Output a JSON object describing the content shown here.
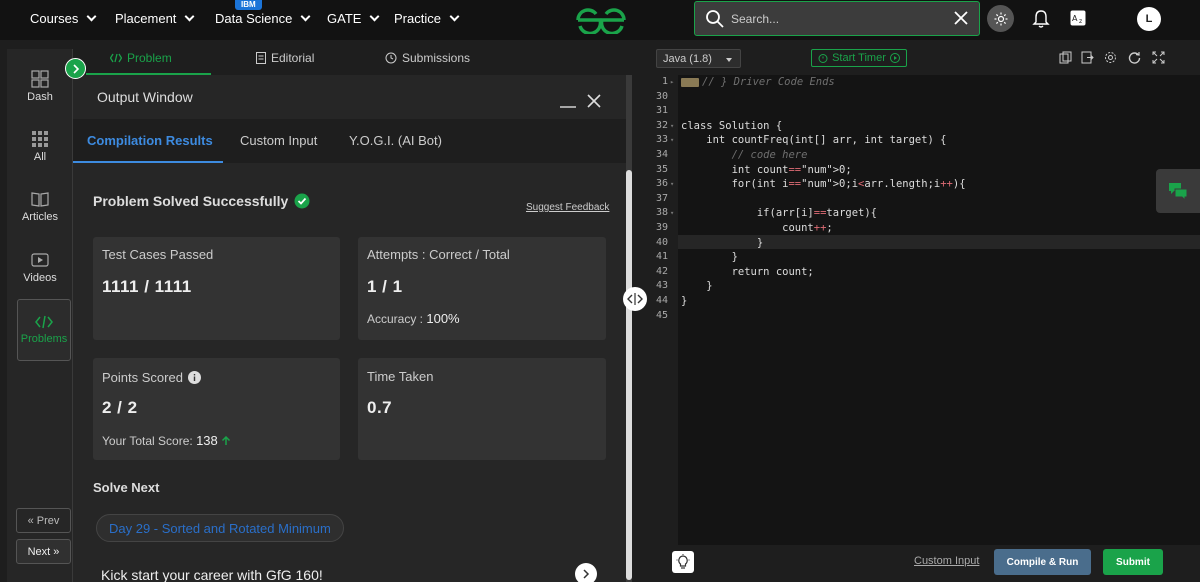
{
  "nav": {
    "items": [
      {
        "label": "Courses"
      },
      {
        "label": "Placement"
      },
      {
        "label": "Data Science"
      },
      {
        "label": "GATE"
      },
      {
        "label": "Practice"
      }
    ],
    "badge": "IBM",
    "search_placeholder": "Search...",
    "avatar_initial": "L",
    "accent_color": "#1aa34a"
  },
  "sidebar": {
    "items": [
      {
        "label": "Dash",
        "icon": "dashboard-icon"
      },
      {
        "label": "All",
        "icon": "grid-icon"
      },
      {
        "label": "Articles",
        "icon": "book-icon"
      },
      {
        "label": "Videos",
        "icon": "play-icon"
      },
      {
        "label": "Problems",
        "icon": "code-icon"
      }
    ],
    "prev_label": "« Prev",
    "next_label": "Next »"
  },
  "problem_tabs": {
    "problem": "Problem",
    "editorial": "Editorial",
    "submissions": "Submissions"
  },
  "output": {
    "title": "Output Window",
    "tabs": [
      "Compilation Results",
      "Custom Input",
      "Y.O.G.I. (AI Bot)"
    ],
    "status": "Problem Solved Successfully",
    "feedback_link": "Suggest Feedback",
    "test_cases_label": "Test Cases Passed",
    "test_cases_value": "1111 / 1111",
    "attempts_label": "Attempts : Correct / Total",
    "attempts_value": "1 / 1",
    "accuracy_label": "Accuracy :",
    "accuracy_value": "100%",
    "points_label": "Points Scored",
    "points_value": "2 / 2",
    "total_score_label": "Your Total Score:",
    "total_score_value": "138",
    "time_label": "Time Taken",
    "time_value": "0.7",
    "solve_next_label": "Solve Next",
    "next_problem": "Day 29 - Sorted and Rotated Minimum",
    "promo": "Kick start your career with GfG 160!"
  },
  "editor": {
    "language": "Java (1.8)",
    "timer_label": "Start Timer",
    "lines": [
      {
        "n": "1",
        "text": "// } Driver Code Ends"
      },
      {
        "n": "30",
        "text": ""
      },
      {
        "n": "31",
        "text": ""
      },
      {
        "n": "32",
        "text": "class Solution {"
      },
      {
        "n": "33",
        "text": "    int countFreq(int[] arr, int target) {"
      },
      {
        "n": "34",
        "text": "        // code here"
      },
      {
        "n": "35",
        "text": "        int count=0;"
      },
      {
        "n": "36",
        "text": "        for(int i=0;i<arr.length;i++){"
      },
      {
        "n": "37",
        "text": ""
      },
      {
        "n": "38",
        "text": "            if(arr[i]==target){"
      },
      {
        "n": "39",
        "text": "                count++;"
      },
      {
        "n": "40",
        "text": "            }"
      },
      {
        "n": "41",
        "text": "        }"
      },
      {
        "n": "42",
        "text": "        return count;"
      },
      {
        "n": "43",
        "text": "    }"
      },
      {
        "n": "44",
        "text": "}"
      },
      {
        "n": "45",
        "text": ""
      }
    ]
  },
  "footer": {
    "custom_input": "Custom Input",
    "compile_run": "Compile & Run",
    "submit": "Submit"
  }
}
